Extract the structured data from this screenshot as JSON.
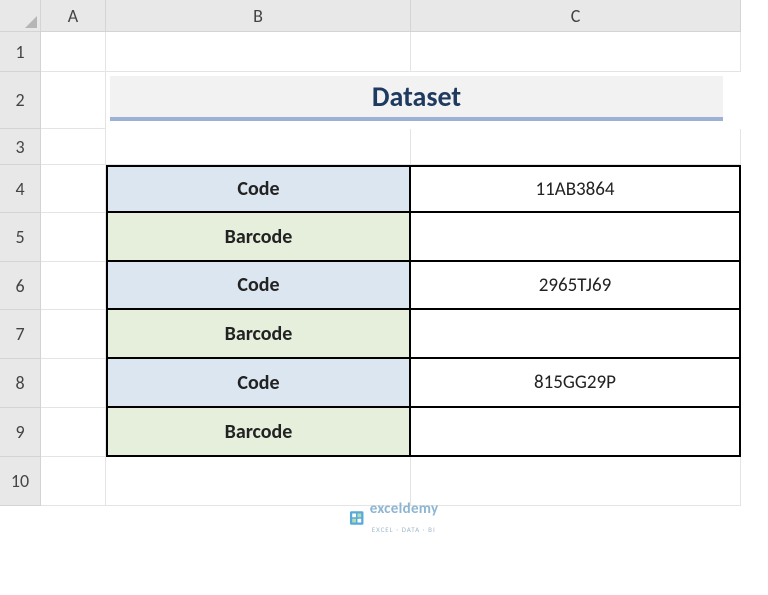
{
  "columns": [
    "A",
    "B",
    "C"
  ],
  "rows": [
    "1",
    "2",
    "3",
    "4",
    "5",
    "6",
    "7",
    "8",
    "9",
    "10"
  ],
  "title": "Dataset",
  "table": {
    "r4": {
      "label": "Code",
      "value": "11AB3864"
    },
    "r5": {
      "label": "Barcode",
      "value": ""
    },
    "r6": {
      "label": "Code",
      "value": "2965TJ69"
    },
    "r7": {
      "label": "Barcode",
      "value": ""
    },
    "r8": {
      "label": "Code",
      "value": "815GG29P"
    },
    "r9": {
      "label": "Barcode",
      "value": ""
    }
  },
  "watermark": {
    "brand": "exceldemy",
    "tagline": "EXCEL · DATA · BI"
  }
}
